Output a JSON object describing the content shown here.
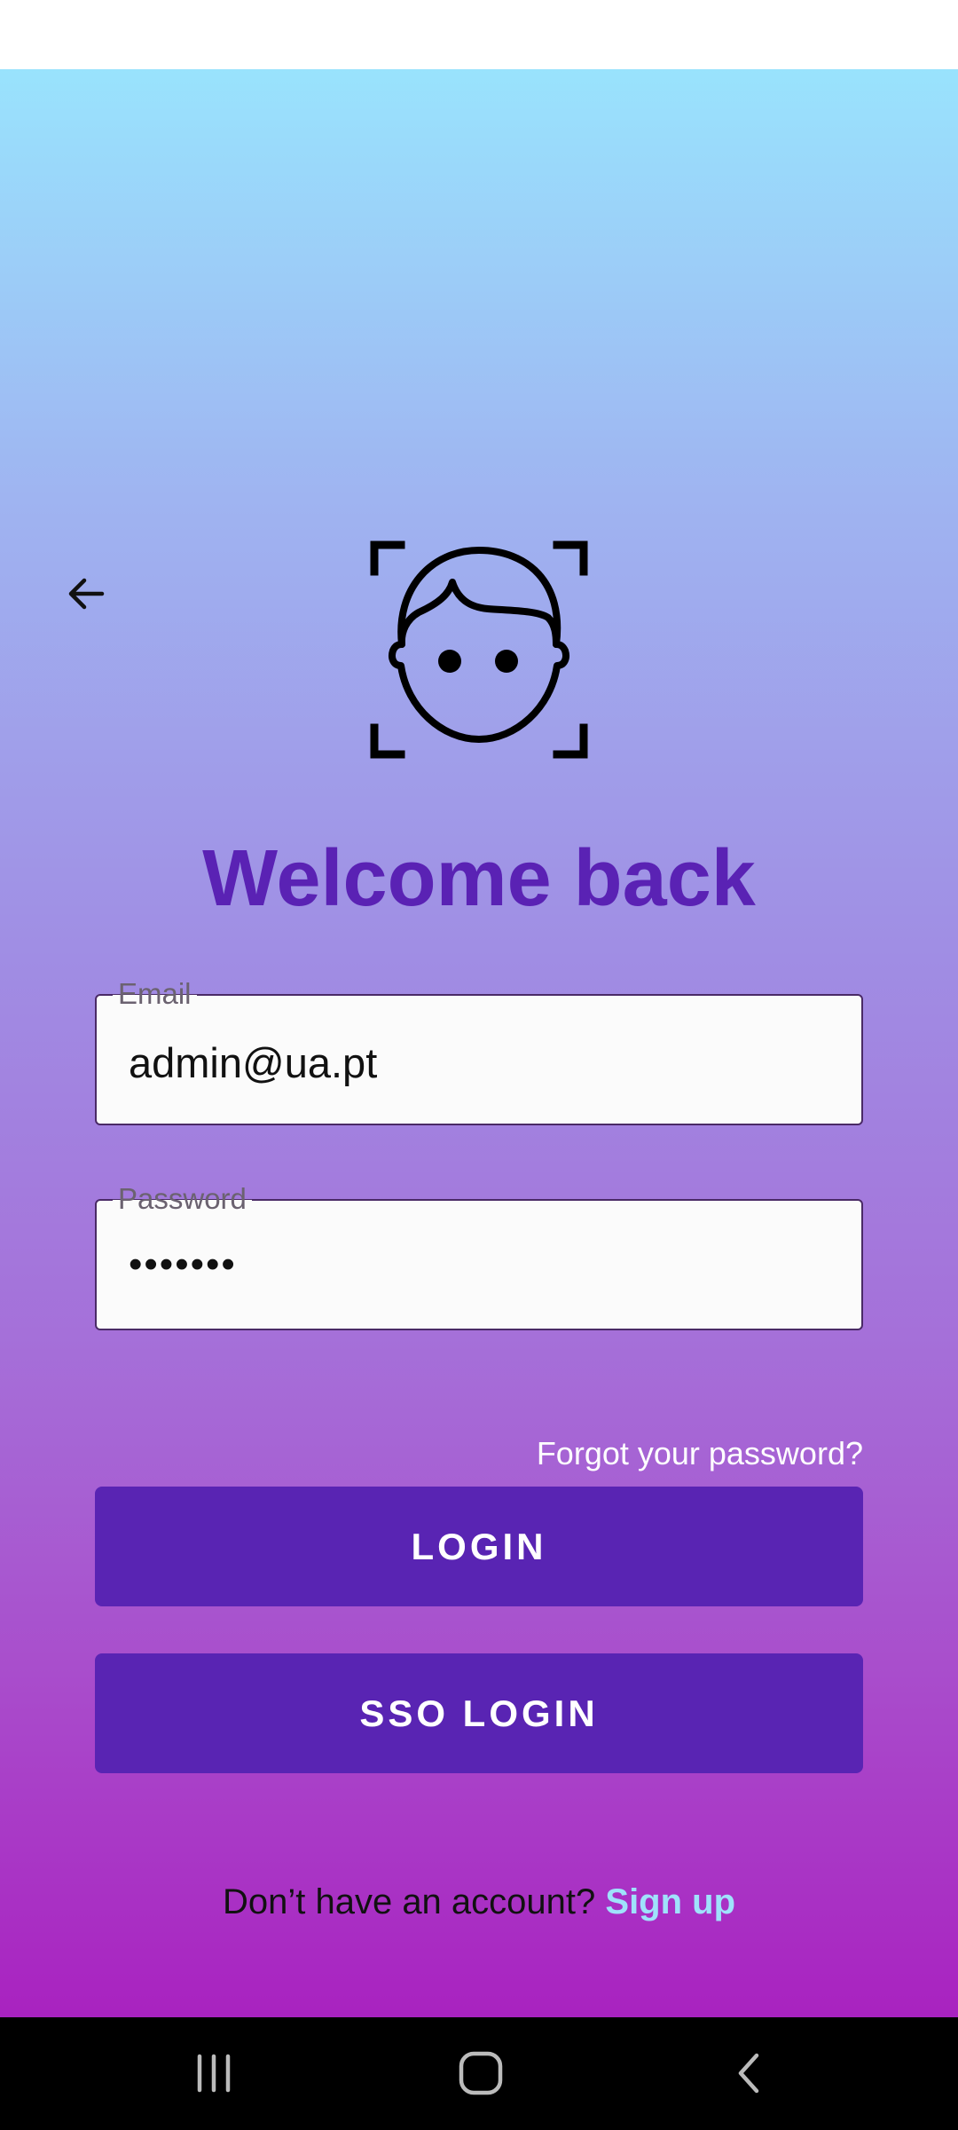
{
  "header": {
    "title": "Welcome back"
  },
  "email_field": {
    "label": "Email",
    "value": "admin@ua.pt"
  },
  "password_field": {
    "label": "Password",
    "masked_value": "•••••••"
  },
  "forgot_password": "Forgot your password?",
  "buttons": {
    "login": "LOGIN",
    "sso_login": "SSO LOGIN"
  },
  "signup": {
    "prompt": "Don’t have an account?",
    "link": "Sign up"
  },
  "icons": {
    "back": "arrow-left-icon",
    "face": "face-scan-icon",
    "nav_recents": "recent-apps-icon",
    "nav_home": "home-icon",
    "nav_back": "chevron-left-icon"
  },
  "colors": {
    "accent": "#5924b3",
    "title": "#5a22b4",
    "link": "#9fe2fb",
    "gradient_top": "#99e3fd",
    "gradient_bottom": "#a922c0"
  }
}
